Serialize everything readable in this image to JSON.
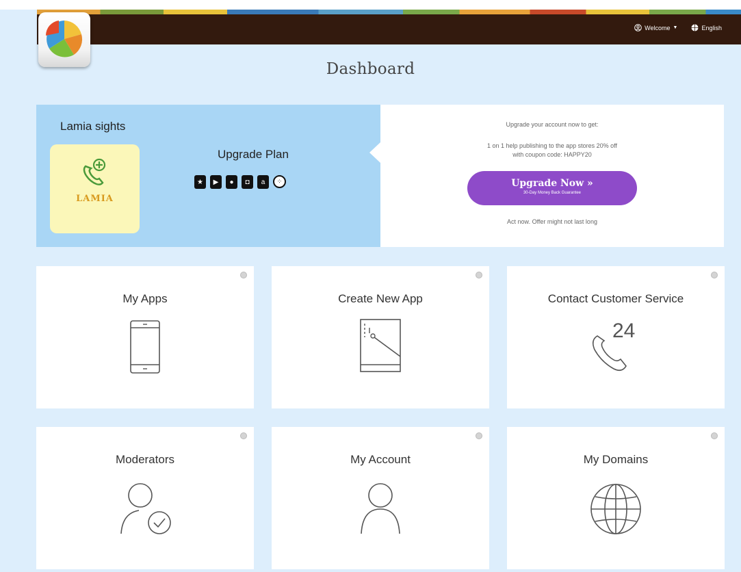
{
  "header": {
    "welcome_label": "Welcome",
    "language_label": "English"
  },
  "page_title": "Dashboard",
  "banner": {
    "app_name": "Lamia sights",
    "app_thumb_text": "LAMIA",
    "upgrade_plan_label": "Upgrade Plan",
    "promo_heading": "Upgrade your account now to get:",
    "promo_line_1": "1 on 1 help publishing to the app stores 20% off",
    "promo_line_2": "with coupon code: HAPPY20",
    "upgrade_button_label": "Upgrade Now »",
    "upgrade_button_sub": "30-Day Money Back Guarantee",
    "promo_footer": "Act now. Offer might not last long"
  },
  "cards": [
    {
      "title": "My Apps",
      "icon": "smartphone-icon"
    },
    {
      "title": "Create New App",
      "icon": "create-app-icon"
    },
    {
      "title": "Contact Customer Service",
      "icon": "phone-24-icon"
    },
    {
      "title": "Moderators",
      "icon": "user-check-icon"
    },
    {
      "title": "My Account",
      "icon": "user-icon"
    },
    {
      "title": "My Domains",
      "icon": "globe-icon"
    }
  ],
  "colors": {
    "page_bg": "#ddeefc",
    "navbar_bg": "#331a0e",
    "banner_left_bg": "#a9d6f5",
    "upgrade_button": "#8e4bc9",
    "app_thumb_bg": "#fbf7b9"
  }
}
